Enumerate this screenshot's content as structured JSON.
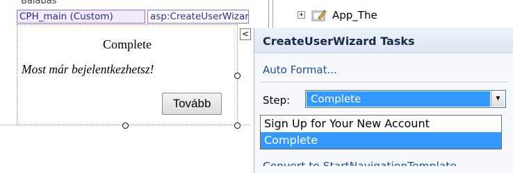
{
  "designer": {
    "cut_off_text": "Balabas",
    "tags": {
      "cph_main": "CPH_main (Custom)",
      "control": "asp:CreateUserWizard#CreateUse"
    },
    "wizard": {
      "title": "Complete",
      "message": "Most már bejelentkezhetsz!",
      "next_button": "Tovább"
    },
    "smart_tag_glyph": "<"
  },
  "tasks_panel": {
    "title": "CreateUserWizard Tasks",
    "auto_format": "Auto Format...",
    "step_label": "Step:",
    "step_selected": "Complete",
    "step_options": [
      "Sign Up for Your New Account",
      "Complete"
    ],
    "convert_link": "Convert to StartNavigationTemplate"
  },
  "explorer": {
    "expand_glyph": "+",
    "item_label": "App_The"
  },
  "colors": {
    "selection_blue": "#3399ff",
    "link_blue": "#1a4fa0",
    "tag_border": "#9b6bd8"
  }
}
